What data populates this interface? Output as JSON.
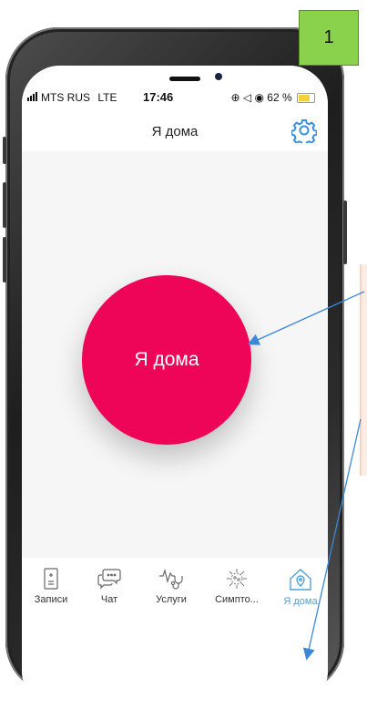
{
  "status_bar": {
    "carrier": "MTS RUS",
    "network": "LTE",
    "time": "17:46",
    "indicators": "⊕ ◁ ◉",
    "battery": "62 %"
  },
  "header": {
    "title": "Я дома",
    "settings_icon": "gear-icon"
  },
  "main": {
    "button_label": "Я дома",
    "button_color": "#ee0558"
  },
  "tabs": [
    {
      "label": "Записи",
      "icon": "document-icon"
    },
    {
      "label": "Чат",
      "icon": "chat-icon"
    },
    {
      "label": "Услуги",
      "icon": "stethoscope-icon"
    },
    {
      "label": "Симпто...",
      "icon": "virus-icon"
    },
    {
      "label": "Я дома",
      "icon": "home-location-icon",
      "active": true
    }
  ],
  "annotation": {
    "step_number": "1",
    "badge_color": "#8bd24c",
    "arrow_color": "#3b88d8"
  },
  "colors": {
    "accent": "#4fa2d9",
    "primary": "#ee0558"
  }
}
